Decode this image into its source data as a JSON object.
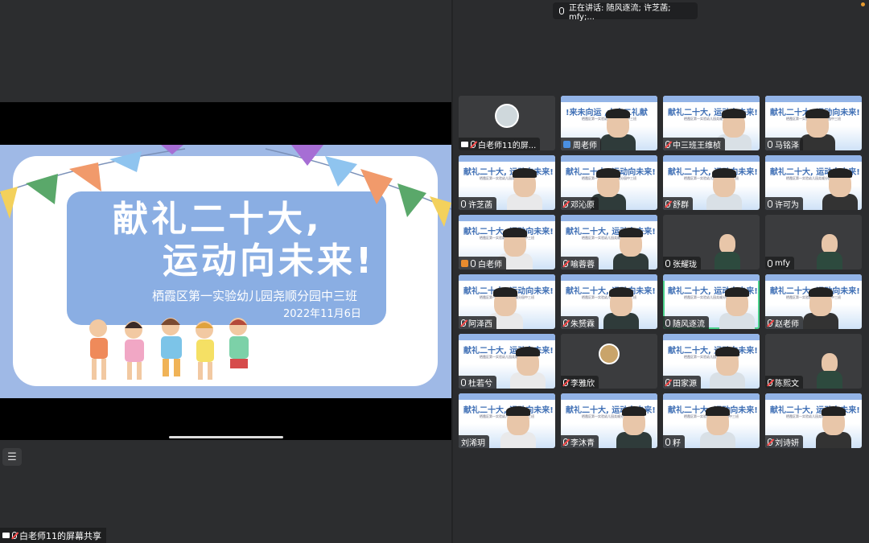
{
  "meeting": {
    "speaking_banner": "正在讲话: 随风逐流; 许芝菡; mfy;...",
    "share_label": "白老师11的屏幕共享"
  },
  "slide": {
    "title_line1": "献礼二十大,",
    "title_line2": "运动向未来!",
    "subtitle": "栖霞区第一实验幼儿园尧顺分园中三班",
    "date": "2022年11月6日"
  },
  "tile_slide_text": "献礼二十大, 运动向未来!",
  "tile_slide_subtext": "栖霞区第一实验幼儿园尧顺分园中三班",
  "tile_mirrored_text": "!来未向运 ,大十二礼献",
  "participants": [
    {
      "name": "白老师11的屏...",
      "bg": "avatar",
      "icons": [
        "screen",
        "mic-off"
      ]
    },
    {
      "name": "周老师",
      "bg": "video",
      "icons": [
        "person"
      ]
    },
    {
      "name": "中三班王维桢",
      "bg": "slide",
      "icons": [
        "mic-off"
      ]
    },
    {
      "name": "马铭泽",
      "bg": "slide",
      "icons": [
        "mic"
      ]
    },
    {
      "name": "许芝菡",
      "bg": "slide",
      "icons": [
        "mic"
      ]
    },
    {
      "name": "邓沁原",
      "bg": "slide",
      "icons": [
        "mic-off"
      ]
    },
    {
      "name": "舒群",
      "bg": "video",
      "icons": [
        "mic-off"
      ]
    },
    {
      "name": "许可为",
      "bg": "slide",
      "icons": [
        "mic"
      ]
    },
    {
      "name": "白老师",
      "bg": "slide",
      "icons": [
        "person-orange",
        "mic"
      ]
    },
    {
      "name": "喻蓉蓉",
      "bg": "slide",
      "icons": [
        "mic-off"
      ]
    },
    {
      "name": "张耀珑",
      "bg": "dark",
      "icons": [
        "mic"
      ]
    },
    {
      "name": "mfy",
      "bg": "dark",
      "icons": [
        "mic"
      ]
    },
    {
      "name": "阿泽西",
      "bg": "slide",
      "icons": [
        "mic-off"
      ]
    },
    {
      "name": "朱赟霖",
      "bg": "video",
      "icons": [
        "mic-off"
      ]
    },
    {
      "name": "随风逐流",
      "bg": "slide",
      "icons": [
        "mic"
      ],
      "active": true
    },
    {
      "name": "赵老师",
      "bg": "slide",
      "icons": [
        "mic-off"
      ]
    },
    {
      "name": "杜若兮",
      "bg": "slide",
      "icons": [
        "mic"
      ]
    },
    {
      "name": "李雅欣",
      "bg": "avatar-dark",
      "icons": [
        "mic-off"
      ]
    },
    {
      "name": "田家源",
      "bg": "slide",
      "icons": [
        "mic-off"
      ]
    },
    {
      "name": "陈熙文",
      "bg": "dark",
      "icons": [
        "mic-off"
      ]
    },
    {
      "name": "刘浠玥",
      "bg": "slide",
      "icons": []
    },
    {
      "name": "李沐青",
      "bg": "slide",
      "icons": [
        "mic-off"
      ]
    },
    {
      "name": "籽",
      "bg": "slide",
      "icons": [
        "mic"
      ]
    },
    {
      "name": "刘诗妍",
      "bg": "slide",
      "icons": [
        "mic-off"
      ]
    }
  ],
  "colors": {
    "active_border": "#4bd28c",
    "accent_blue": "#8aaee3",
    "mute_red": "#ff4d4d"
  }
}
